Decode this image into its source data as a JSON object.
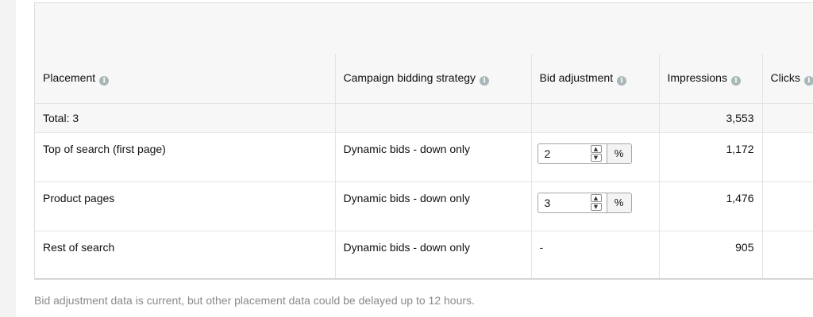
{
  "table": {
    "headers": [
      {
        "label": "Placement",
        "key": "placement"
      },
      {
        "label": "Campaign bidding strategy",
        "key": "strategy"
      },
      {
        "label": "Bid adjustment",
        "key": "bid"
      },
      {
        "label": "Impressions",
        "key": "impressions"
      },
      {
        "label": "Clicks",
        "key": "clicks"
      }
    ],
    "total": {
      "label": "Total: 3",
      "impressions": "3,553"
    },
    "rows": [
      {
        "placement": "Top of search (first page)",
        "strategy": "Dynamic bids - down only",
        "bid_value": "2",
        "bid_unit": "%",
        "impressions": "1,172"
      },
      {
        "placement": "Product pages",
        "strategy": "Dynamic bids - down only",
        "bid_value": "3",
        "bid_unit": "%",
        "impressions": "1,476"
      },
      {
        "placement": "Rest of search",
        "strategy": "Dynamic bids - down only",
        "bid_value": "-",
        "impressions": "905"
      }
    ]
  },
  "icons": {
    "info": "info-icon",
    "step_up": "chevron-up-icon",
    "step_down": "chevron-down-icon"
  },
  "footer": {
    "note": "Bid adjustment data is current, but other placement data could be delayed up to 12 hours."
  }
}
